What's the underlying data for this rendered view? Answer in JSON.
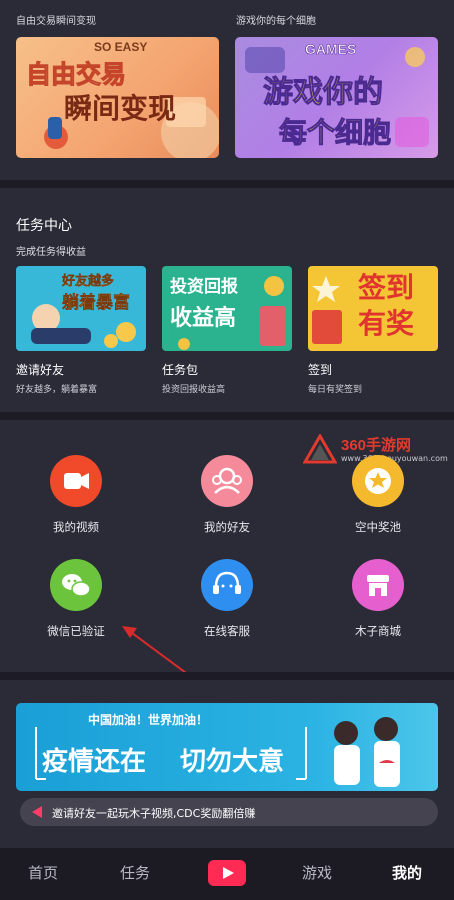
{
  "banners": {
    "left": {
      "caption": "自由交易瞬间变现",
      "tag": "SO EASY",
      "line1": "自由交易",
      "line2": "瞬间变现"
    },
    "right": {
      "caption": "游戏你的每个细胞",
      "tag": "GAMES",
      "line1": "游戏你的",
      "line2": "每个细胞"
    }
  },
  "task_center": {
    "title": "任务中心",
    "subtitle": "完成任务得收益",
    "cards": [
      {
        "art_line1": "好友越多",
        "art_line2": "躺着暴富",
        "title": "邀请好友",
        "sub": "好友越多，躺着暴富"
      },
      {
        "art_line1": "投资回报",
        "art_line2": "收益高",
        "title": "任务包",
        "sub": "投资回报收益高"
      },
      {
        "art_line1": "签到",
        "art_line2": "有奖",
        "title": "签到",
        "sub": "每日有奖签到"
      }
    ]
  },
  "watermark": {
    "brand": "360手游网",
    "url": "www.360shouyouwan.com"
  },
  "grid": [
    {
      "label": "我的视频",
      "icon": "video-camera-icon",
      "color": "#f04a2a"
    },
    {
      "label": "我的好友",
      "icon": "friends-icon",
      "color": "#f58a9a"
    },
    {
      "label": "空中奖池",
      "icon": "prize-star-icon",
      "color": "#f5b92d"
    },
    {
      "label": "微信已验证",
      "icon": "wechat-icon",
      "color": "#6bc43c"
    },
    {
      "label": "在线客服",
      "icon": "customer-service-icon",
      "color": "#2f8ff0"
    },
    {
      "label": "木子商城",
      "icon": "shop-icon",
      "color": "#e65fcf"
    }
  ],
  "ad_banner": {
    "top": "中国加油！世界加油！",
    "line1": "疫情还在",
    "line2": "切勿大意"
  },
  "marquee": "邀请好友一起玩木子视频,CDC奖励翻倍赚",
  "nav": {
    "home": "首页",
    "task": "任务",
    "game": "游戏",
    "mine": "我的"
  },
  "colors": {
    "bg": "#24232f",
    "section": "#2b2a37",
    "accent": "#ff2b55"
  }
}
